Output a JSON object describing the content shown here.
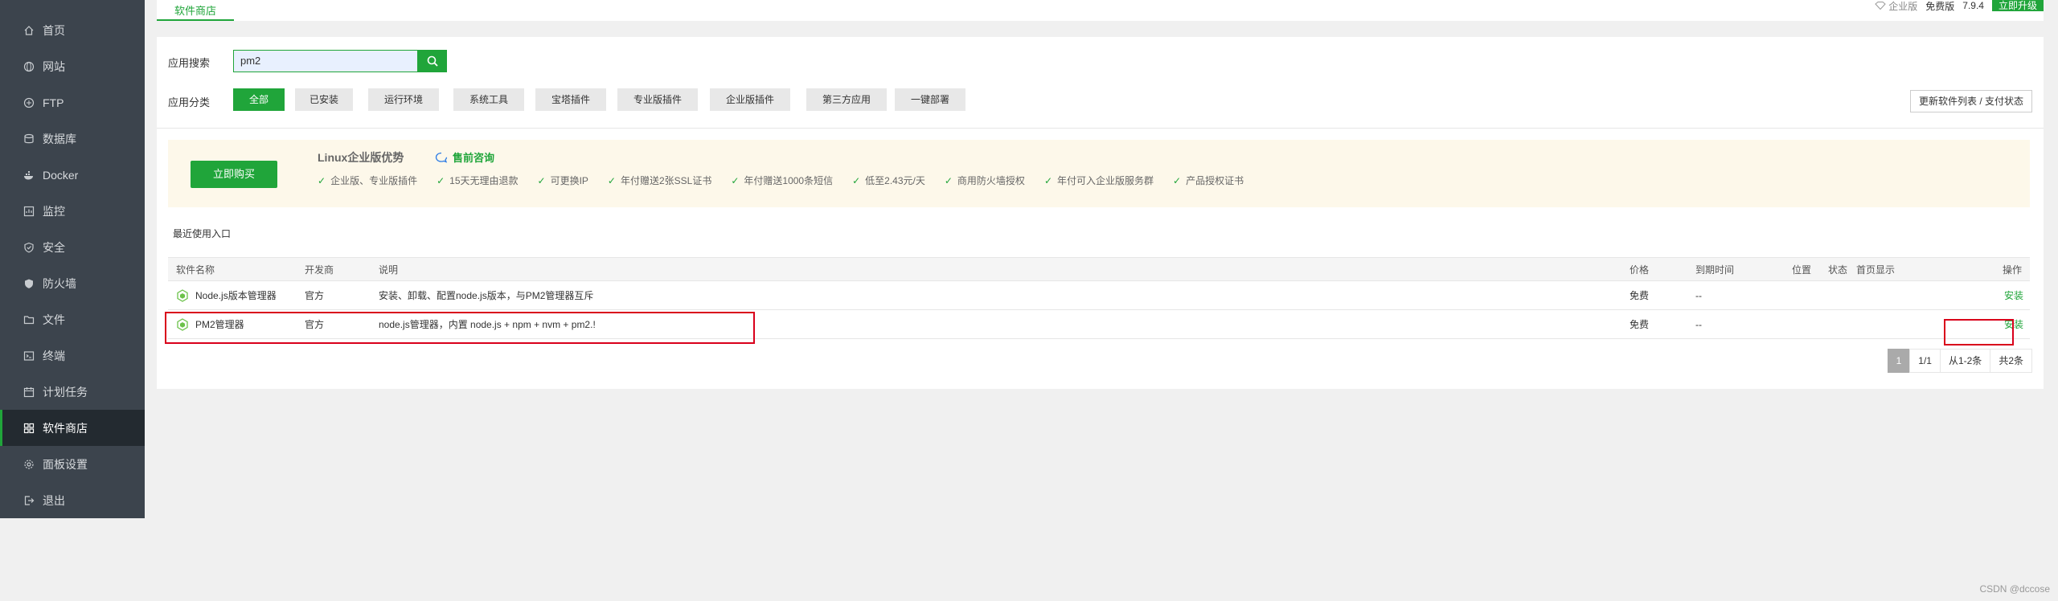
{
  "sidebar": {
    "items": [
      {
        "label": "首页",
        "icon": "home-icon"
      },
      {
        "label": "网站",
        "icon": "globe-icon"
      },
      {
        "label": "FTP",
        "icon": "ftp-icon"
      },
      {
        "label": "数据库",
        "icon": "database-icon"
      },
      {
        "label": "Docker",
        "icon": "docker-icon"
      },
      {
        "label": "监控",
        "icon": "monitor-icon"
      },
      {
        "label": "安全",
        "icon": "shield-icon"
      },
      {
        "label": "防火墙",
        "icon": "firewall-icon"
      },
      {
        "label": "文件",
        "icon": "folder-icon"
      },
      {
        "label": "终端",
        "icon": "terminal-icon"
      },
      {
        "label": "计划任务",
        "icon": "calendar-icon"
      },
      {
        "label": "软件商店",
        "icon": "grid-icon",
        "active": true
      },
      {
        "label": "面板设置",
        "icon": "gear-icon"
      },
      {
        "label": "退出",
        "icon": "logout-icon"
      }
    ]
  },
  "top": {
    "tab": "软件商店",
    "badge": "企业版",
    "edition": "免费版",
    "version": "7.9.4",
    "upgrade": "立即升级"
  },
  "search": {
    "label": "应用搜索",
    "value": "pm2"
  },
  "categories": {
    "label": "应用分类",
    "items": [
      "全部",
      "已安装",
      "运行环境",
      "系统工具",
      "宝塔插件",
      "专业版插件",
      "企业版插件",
      "第三方应用",
      "一键部署"
    ],
    "active": "全部"
  },
  "refresh_label": "更新软件列表 / 支付状态",
  "promo": {
    "buy": "立即购买",
    "title": "Linux企业版优势",
    "consult": "售前咨询",
    "benefits": [
      "企业版、专业版插件",
      "15天无理由退款",
      "可更换IP",
      "年付赠送2张SSL证书",
      "年付赠送1000条短信",
      "低至2.43元/天",
      "商用防火墙授权",
      "年付可入企业版服务群",
      "产品授权证书"
    ]
  },
  "recent_label": "最近使用入口",
  "table": {
    "headers": {
      "name": "软件名称",
      "dev": "开发商",
      "desc": "说明",
      "price": "价格",
      "expire": "到期时间",
      "pos": "位置",
      "status": "状态",
      "home": "首页显示",
      "op": "操作"
    },
    "rows": [
      {
        "name": "Node.js版本管理器",
        "dev": "官方",
        "desc": "安装、卸载、配置node.js版本，与PM2管理器互斥",
        "price": "免费",
        "expire": "--",
        "op": "安装"
      },
      {
        "name": "PM2管理器",
        "dev": "官方",
        "desc": "node.js管理器，内置 node.js + npm + nvm + pm2.!",
        "price": "免费",
        "expire": "--",
        "op": "安装"
      }
    ]
  },
  "pager": {
    "current": "1",
    "pages": "1/1",
    "range": "从1-2条",
    "total": "共2条"
  },
  "watermark": "CSDN @dccose",
  "colors": {
    "accent": "#20a53a",
    "sidebar": "#3c444d",
    "highlight": "#d9001b"
  }
}
